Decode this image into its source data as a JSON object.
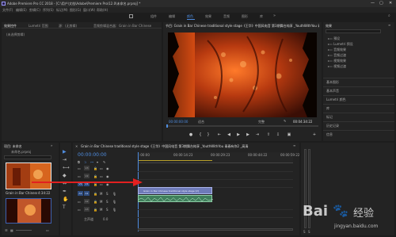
{
  "window": {
    "title": "Adobe Premiere Pro CC 2018 - [C:\\用户\\文档\\Adobe\\Premiere Pro\\12.0\\未命名.prproj] *",
    "controls": [
      "—",
      "▢",
      "✕"
    ]
  },
  "menubar": {
    "items": [
      "文件(F)",
      "编辑(E)",
      "剪辑(C)",
      "序列(S)",
      "标记(M)",
      "图形(G)",
      "窗口(W)",
      "帮助(H)"
    ]
  },
  "workspaces": {
    "items": [
      "组件",
      "编辑",
      "颜色",
      "效果",
      "音频",
      "图形",
      "库"
    ],
    "active_index": 3
  },
  "source_panel": {
    "tabs": [
      "效果控件",
      "Lumetri 范围",
      "源：(无剪辑)",
      "音频剪辑混合器：Grain in Bar Chinese"
    ],
    "empty_text": "(未选择剪辑)"
  },
  "program_monitor": {
    "title": "节目: Grain in Bar Chinese traditional style stage《王华》中国风电音 第3期舞台纯享 _YouthWithYou 青春有你2",
    "timecode": "00:00:00:00",
    "fit_label": "适合",
    "quality_label": "完整",
    "duration": "00:04:34:22"
  },
  "effects_panel": {
    "title": "效果",
    "items": [
      {
        "label": "预设",
        "level": 0
      },
      {
        "label": "Lumetri 预设",
        "level": 0
      },
      {
        "label": "音频效果",
        "level": 0
      },
      {
        "label": "音频过渡",
        "level": 0
      },
      {
        "label": "视频效果",
        "level": 0
      },
      {
        "label": "视频过渡",
        "level": 0
      }
    ],
    "sections": [
      "基本图形",
      "基本声音",
      "Lumetri 颜色",
      "库",
      "标记",
      "历史记录",
      "信息"
    ]
  },
  "project_panel": {
    "title": "项目: 未命名",
    "file": "未命名.prproj",
    "clip_name": "Grain in Bar Chinese t...",
    "clip_duration": "4:34:22"
  },
  "timeline": {
    "title": "Grain in Bar Chinese traditional style stage《王华》中国风电音 第3期舞台纯享 _YouthWithYou 青春有你2 _高清",
    "timecode": "00:00:00:00",
    "video_tracks": [
      "V3",
      "V2",
      "V1"
    ],
    "audio_tracks": [
      "A1",
      "A2",
      "A3"
    ],
    "master_label": "主声道",
    "master_value": "0.0",
    "clip_label": "Grain in Bar Chinese traditional style stage [V]",
    "ruler_ticks": [
      ":00:00",
      "00:00:14:23",
      "00:00:29:23",
      "00:00:44:22",
      "00:00:59:22"
    ]
  },
  "watermark": {
    "brand": "Bai",
    "suffix": "经验",
    "url": "jingyan.baidu.com"
  }
}
